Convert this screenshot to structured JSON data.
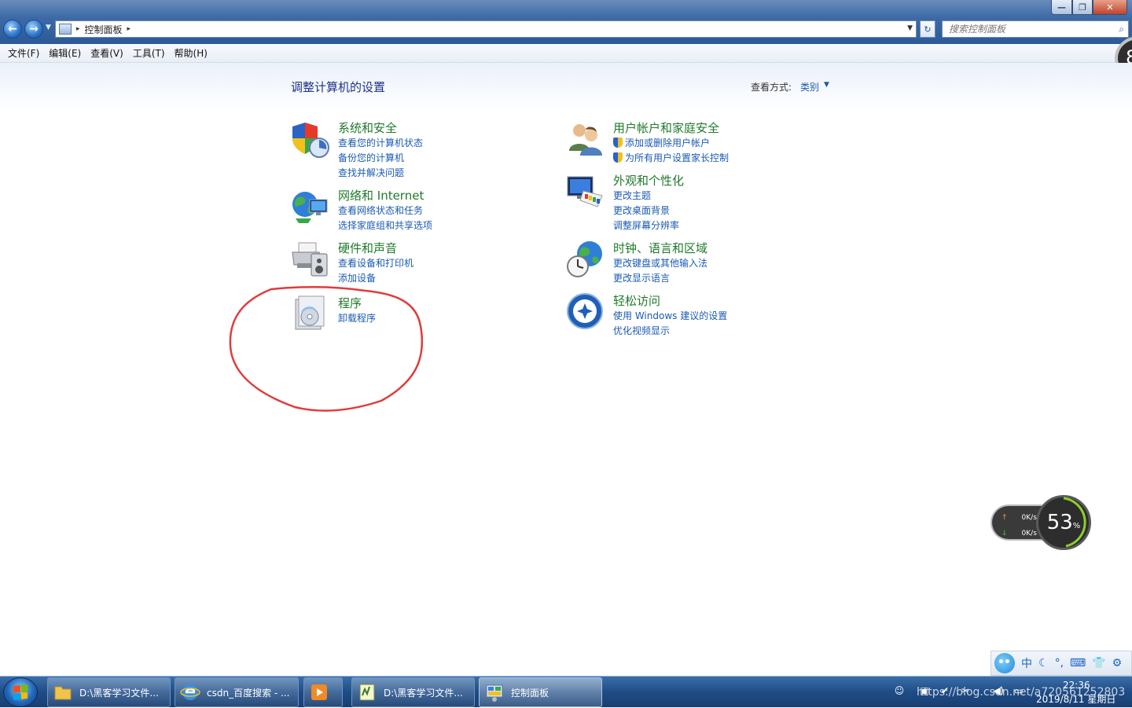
{
  "window": {
    "caption": {
      "minimize": "—",
      "maximize": "❐",
      "close": "✕"
    },
    "nav": {
      "back": "←",
      "forward": "→",
      "dropdown": "▼"
    },
    "breadcrumb": {
      "location": "控制面板",
      "sep1": "▸",
      "sep2": "▸",
      "dropdown": "▼"
    },
    "refresh": "↻",
    "search": {
      "placeholder": "搜索控制面板",
      "icon": "⌕"
    }
  },
  "menu": [
    "文件(F)",
    "编辑(E)",
    "查看(V)",
    "工具(T)",
    "帮助(H)"
  ],
  "edge_gauge": "8",
  "content": {
    "title": "调整计算机的设置",
    "view_by_label": "查看方式:",
    "view_by_value": "类别",
    "view_by_caret": "▼",
    "categories": [
      {
        "key": "system",
        "title": "系统和安全",
        "icon": "shield-icon",
        "links": [
          "查看您的计算机状态",
          "备份您的计算机",
          "查找并解决问题"
        ]
      },
      {
        "key": "users",
        "title": "用户帐户和家庭安全",
        "icon": "users-icon",
        "links": [
          "添加或删除用户帐户",
          "为所有用户设置家长控制"
        ]
      },
      {
        "key": "network",
        "title": "网络和 Internet",
        "icon": "globe-network-icon",
        "links": [
          "查看网络状态和任务",
          "选择家庭组和共享选项"
        ]
      },
      {
        "key": "appearance",
        "title": "外观和个性化",
        "icon": "monitor-palette-icon",
        "links": [
          "更改主题",
          "更改桌面背景",
          "调整屏幕分辨率"
        ]
      },
      {
        "key": "hardware",
        "title": "硬件和声音",
        "icon": "printer-speaker-icon",
        "links": [
          "查看设备和打印机",
          "添加设备"
        ]
      },
      {
        "key": "clock",
        "title": "时钟、语言和区域",
        "icon": "clock-globe-icon",
        "links": [
          "更改键盘或其他输入法",
          "更改显示语言"
        ]
      },
      {
        "key": "programs",
        "title": "程序",
        "icon": "programs-disc-icon",
        "links": [
          "卸载程序"
        ]
      },
      {
        "key": "ease",
        "title": "轻松访问",
        "icon": "ease-of-access-icon",
        "links": [
          "使用 Windows 建议的设置",
          "优化视频显示"
        ]
      }
    ]
  },
  "netmon": {
    "upload": "0K/s",
    "download": "0K/s",
    "arrow_up": "↑",
    "arrow_down": "↓",
    "percent": "53",
    "percent_unit": "%"
  },
  "ime": [
    "中",
    "☾",
    "°,",
    "⌨",
    "👕",
    "⚙"
  ],
  "taskbar": {
    "tasks": [
      {
        "label": "D:\\黑客学习文件...",
        "icon": "folder-icon"
      },
      {
        "label": "csdn_百度搜索 - ...",
        "icon": "ie-icon"
      },
      {
        "label": "",
        "icon": "media-player-icon"
      },
      {
        "label": "D:\\黑客学习文件...",
        "icon": "notepad-icon"
      },
      {
        "label": "控制面板",
        "icon": "control-panel-icon"
      }
    ],
    "tray_icons": [
      "☺",
      "▣",
      "✔",
      "✂",
      "◀)",
      "▭"
    ],
    "watermark": "https://blog.csdn.net/a720561252803",
    "time": "22:36",
    "date": "2019/8/11 星期日"
  },
  "colors": {
    "link": "#1a5ab4",
    "category_title": "#1f7a2a",
    "heading": "#1e3287",
    "annotation": "#e03c3c"
  }
}
